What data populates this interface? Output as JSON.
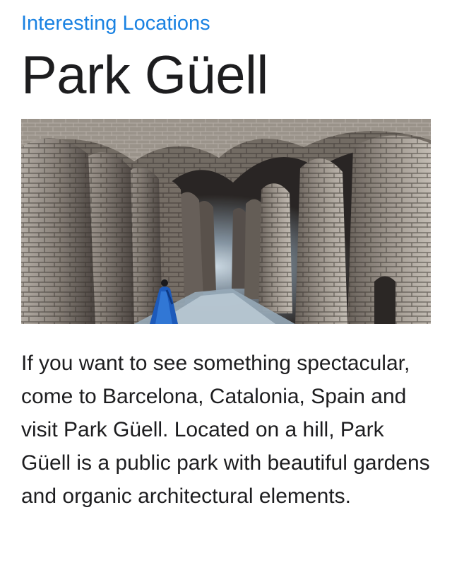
{
  "breadcrumb": {
    "link_label": "Interesting Locations"
  },
  "article": {
    "title": "Park Güell",
    "image": {
      "alt": "Park Güell",
      "icon": "photo-stone-colonnade"
    },
    "paragraph": "If you want to see something spectacular, come to Barcelona, Catalonia, Spain and visit Park Güell. Located on a hill, Park Güell is a public park with beautiful gardens and organic architectural elements."
  },
  "colors": {
    "link": "#1a82e2",
    "text": "#1d1d1f",
    "background": "#ffffff"
  }
}
